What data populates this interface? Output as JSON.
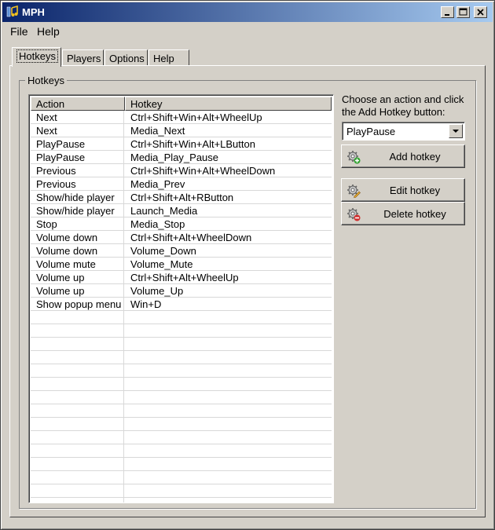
{
  "window": {
    "title": "MPH"
  },
  "menu": {
    "file": "File",
    "help": "Help"
  },
  "tabs": [
    "Hotkeys",
    "Players",
    "Options",
    "Help"
  ],
  "group": {
    "legend": "Hotkeys"
  },
  "table": {
    "columns": [
      "Action",
      "Hotkey"
    ],
    "rows": [
      {
        "action": "Next",
        "hotkey": "Ctrl+Shift+Win+Alt+WheelUp"
      },
      {
        "action": "Next",
        "hotkey": "Media_Next"
      },
      {
        "action": "PlayPause",
        "hotkey": "Ctrl+Shift+Win+Alt+LButton"
      },
      {
        "action": "PlayPause",
        "hotkey": "Media_Play_Pause"
      },
      {
        "action": "Previous",
        "hotkey": "Ctrl+Shift+Win+Alt+WheelDown"
      },
      {
        "action": "Previous",
        "hotkey": "Media_Prev"
      },
      {
        "action": "Show/hide player",
        "hotkey": "Ctrl+Shift+Alt+RButton"
      },
      {
        "action": "Show/hide player",
        "hotkey": "Launch_Media"
      },
      {
        "action": "Stop",
        "hotkey": "Media_Stop"
      },
      {
        "action": "Volume down",
        "hotkey": "Ctrl+Shift+Alt+WheelDown"
      },
      {
        "action": "Volume down",
        "hotkey": "Volume_Down"
      },
      {
        "action": "Volume mute",
        "hotkey": "Volume_Mute"
      },
      {
        "action": "Volume up",
        "hotkey": "Ctrl+Shift+Alt+WheelUp"
      },
      {
        "action": "Volume up",
        "hotkey": "Volume_Up"
      },
      {
        "action": "Show popup menu",
        "hotkey": "Win+D"
      }
    ]
  },
  "side": {
    "instruction": "Choose an action and click the Add Hotkey button:",
    "selected_action": "PlayPause",
    "add_button": "Add hotkey",
    "edit_button": "Edit hotkey",
    "delete_button": "Delete hotkey"
  },
  "colors": {
    "title_start": "#0a246a",
    "title_end": "#a6caf0",
    "face": "#d4d0c8"
  },
  "icons": {
    "app": "music-note-icon",
    "add": "gear-plus-icon",
    "edit": "gear-pencil-icon",
    "delete": "gear-minus-icon"
  }
}
